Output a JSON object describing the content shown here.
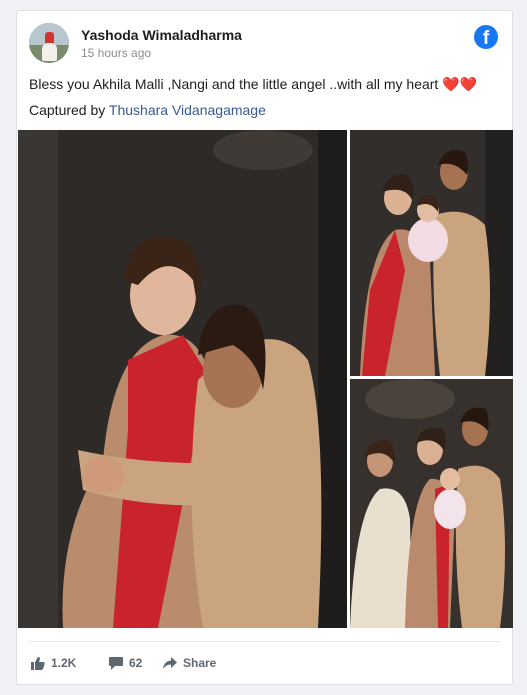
{
  "post": {
    "author": "Yashoda Wimaladharma",
    "timestamp": "15 hours ago",
    "caption_line1": "Bless you Akhila Malli ,Nangi and the little angel ..with all my heart",
    "caption_line1_emoji": "❤️❤️",
    "caption_line2_prefix": "Captured by ",
    "caption_line2_link": "Thushara Vidanagamage"
  },
  "reactions": {
    "likes": "1.2K",
    "comments": "62",
    "share_label": "Share"
  },
  "colors": {
    "facebook_blue": "#1877f2",
    "link_blue": "#385898",
    "heart_red": "#e0245e"
  },
  "icons": [
    "user-avatar",
    "facebook-logo-icon",
    "like-icon",
    "comment-icon",
    "share-icon"
  ]
}
